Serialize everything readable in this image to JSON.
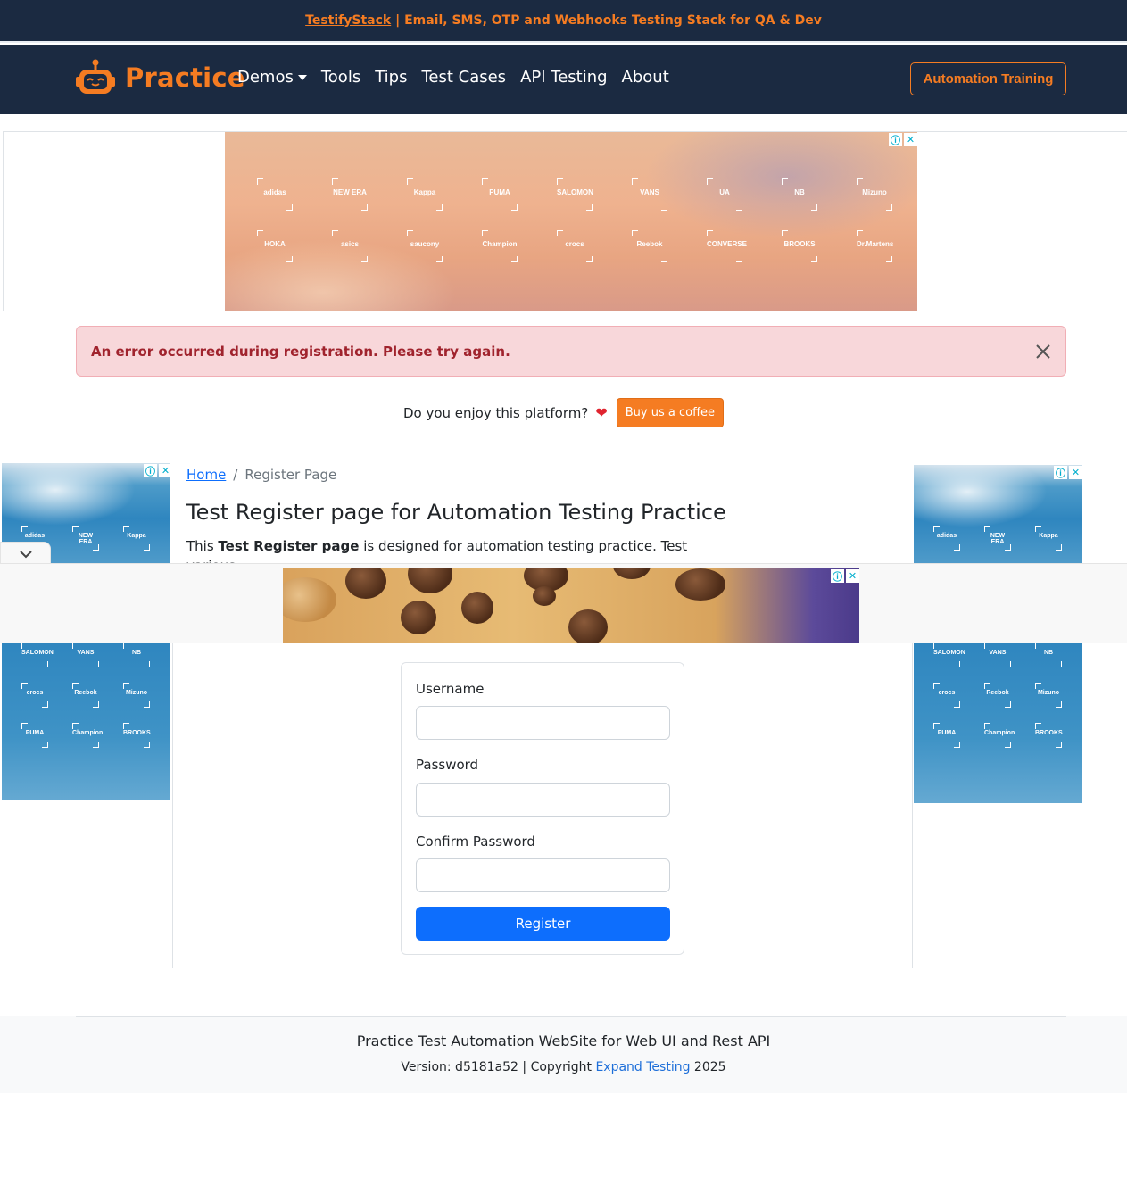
{
  "promo": {
    "link_text": "TestifyStack",
    "rest_text": " | Email, SMS, OTP and Webhooks Testing Stack for QA & Dev"
  },
  "navbar": {
    "brand": "Practice",
    "items": [
      {
        "label": "Demos",
        "dropdown": true
      },
      {
        "label": "Tools"
      },
      {
        "label": "Tips"
      },
      {
        "label": "Test Cases"
      },
      {
        "label": "API Testing"
      },
      {
        "label": "About"
      }
    ],
    "cta": "Automation Training"
  },
  "ads": {
    "info_glyph": "ⓘ",
    "close_glyph": "✕",
    "brands_row1": [
      "adidas",
      "NEW ERA",
      "Kappa",
      "PUMA",
      "SALOMON",
      "VANS",
      "UA",
      "NB",
      "Mizuno"
    ],
    "brands_row2": [
      "HOKA",
      "asics",
      "saucony",
      "Champion",
      "crocs",
      "Reebok",
      "CONVERSE",
      "BROOKS",
      "Dr.Martens"
    ],
    "side_top": [
      "adidas",
      "NEW ERA",
      "Kappa"
    ],
    "side_bottom": [
      "SALOMON",
      "VANS",
      "NB",
      "crocs",
      "Reebok",
      "Mizuno",
      "PUMA",
      "Champion",
      "BROOKS"
    ]
  },
  "alert": {
    "message": "An error occurred during registration. Please try again."
  },
  "coffee": {
    "text": "Do you enjoy this platform?",
    "heart": "❤",
    "button": "Buy us a coffee"
  },
  "breadcrumb": {
    "home": "Home",
    "separator": "/",
    "current": "Register Page"
  },
  "page": {
    "title": "Test Register page for Automation Testing Practice",
    "intro_pre": "This ",
    "intro_bold": "Test Register page",
    "intro_post": " is designed for automation testing practice. Test various"
  },
  "form": {
    "username_label": "Username",
    "username_value": "",
    "password_label": "Password",
    "password_value": "",
    "confirm_label": "Confirm Password",
    "confirm_value": "",
    "submit": "Register"
  },
  "footer": {
    "title": "Practice Test Automation WebSite for Web UI and Rest API",
    "copy_pre": "Version: d5181a52 | Copyright ",
    "copy_link": "Expand Testing",
    "copy_post": " 2025"
  },
  "colors": {
    "navy": "#1b2a41",
    "accent": "#f57c22",
    "primary": "#0d6efd",
    "alert_bg": "#f8d7da",
    "alert_text": "#a0232d"
  }
}
